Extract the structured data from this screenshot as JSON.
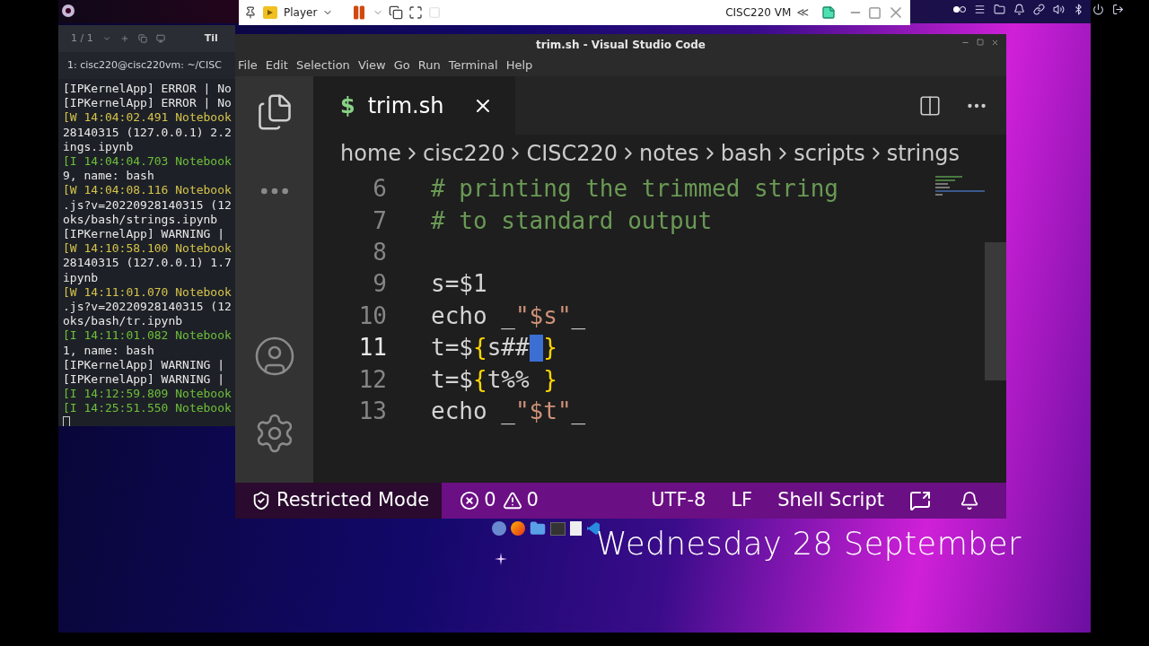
{
  "vm_toolbar": {
    "menu": "Player",
    "vm_name": "CISC220 VM",
    "collapse": "≪"
  },
  "terminal": {
    "page": "1 / 1",
    "title": "Til",
    "tab": "1: cisc220@cisc220vm: ~/CISC",
    "lines": [
      {
        "text": "[IPKernelApp] ERROR | No",
        "kind": "plain"
      },
      {
        "text": "[IPKernelApp] ERROR | No",
        "kind": "plain"
      },
      {
        "text": "[W 14:04:02.491 Notebook",
        "kind": "warn"
      },
      {
        "text": "28140315 (127.0.0.1) 2.2",
        "kind": "plain"
      },
      {
        "text": "ings.ipynb",
        "kind": "plain"
      },
      {
        "text": "[I 14:04:04.703 Notebook",
        "kind": "info"
      },
      {
        "text": "9, name: bash",
        "kind": "plain"
      },
      {
        "text": "[W 14:04:08.116 Notebook",
        "kind": "warn"
      },
      {
        "text": ".js?v=20220928140315 (12",
        "kind": "plain"
      },
      {
        "text": "oks/bash/strings.ipynb",
        "kind": "plain"
      },
      {
        "text": "[IPKernelApp] WARNING |",
        "kind": "plain"
      },
      {
        "text": "[W 14:10:58.100 Notebook",
        "kind": "warn"
      },
      {
        "text": "28140315 (127.0.0.1) 1.7",
        "kind": "plain"
      },
      {
        "text": "ipynb",
        "kind": "plain"
      },
      {
        "text": "[W 14:11:01.070 Notebook",
        "kind": "warn"
      },
      {
        "text": ".js?v=20220928140315 (12",
        "kind": "plain"
      },
      {
        "text": "oks/bash/tr.ipynb",
        "kind": "plain"
      },
      {
        "text": "[I 14:11:01.082 Notebook",
        "kind": "info"
      },
      {
        "text": "1, name: bash",
        "kind": "plain"
      },
      {
        "text": "[IPKernelApp] WARNING |",
        "kind": "plain"
      },
      {
        "text": "[IPKernelApp] WARNING |",
        "kind": "plain"
      },
      {
        "text": "[I 14:12:59.809 Notebook",
        "kind": "info"
      },
      {
        "text": "[I 14:25:51.550 Notebook",
        "kind": "info"
      }
    ]
  },
  "vscode": {
    "title": "trim.sh - Visual Studio Code",
    "menu": [
      "File",
      "Edit",
      "Selection",
      "View",
      "Go",
      "Run",
      "Terminal",
      "Help"
    ],
    "tab": {
      "icon": "$",
      "label": "trim.sh"
    },
    "breadcrumbs": [
      "home",
      "cisc220",
      "CISC220",
      "notes",
      "bash",
      "scripts",
      "strings"
    ],
    "lines": [
      {
        "number": "6",
        "active": false,
        "tokens": [
          {
            "text": "# printing the trimmed string",
            "kind": "comment"
          }
        ]
      },
      {
        "number": "7",
        "active": false,
        "tokens": [
          {
            "text": "# to standard output",
            "kind": "comment"
          }
        ]
      },
      {
        "number": "8",
        "active": false
      },
      {
        "number": "9",
        "active": false,
        "tokens": [
          {
            "text": "s=$1",
            "kind": "plain"
          }
        ]
      },
      {
        "number": "10",
        "active": false,
        "tokens": [
          {
            "text": "echo _",
            "kind": "plain"
          },
          {
            "text": "\"$s\"",
            "kind": "string"
          },
          {
            "text": "_",
            "kind": "plain"
          }
        ]
      },
      {
        "number": "11",
        "active": true,
        "tokens": [
          {
            "text": "t=$",
            "kind": "plain"
          },
          {
            "text": "{",
            "kind": "brace"
          },
          {
            "text": "s##",
            "kind": "plain"
          },
          {
            "text": "}",
            "kind": "brace",
            "caret_before": true
          }
        ]
      },
      {
        "number": "12",
        "active": false,
        "tokens": [
          {
            "text": "t=$",
            "kind": "plain"
          },
          {
            "text": "{",
            "kind": "brace"
          },
          {
            "text": "t%% ",
            "kind": "plain"
          },
          {
            "text": "}",
            "kind": "brace"
          }
        ]
      },
      {
        "number": "13",
        "active": false,
        "tokens": [
          {
            "text": "echo _",
            "kind": "plain"
          },
          {
            "text": "\"$t\"",
            "kind": "string"
          },
          {
            "text": "_",
            "kind": "plain"
          }
        ]
      }
    ],
    "status": {
      "mode": "Restricted Mode",
      "errors": "0",
      "warnings": "0",
      "encoding": "UTF-8",
      "eol": "LF",
      "language": "Shell Script"
    }
  },
  "desktop": {
    "date": "Wednesday 28 September"
  }
}
